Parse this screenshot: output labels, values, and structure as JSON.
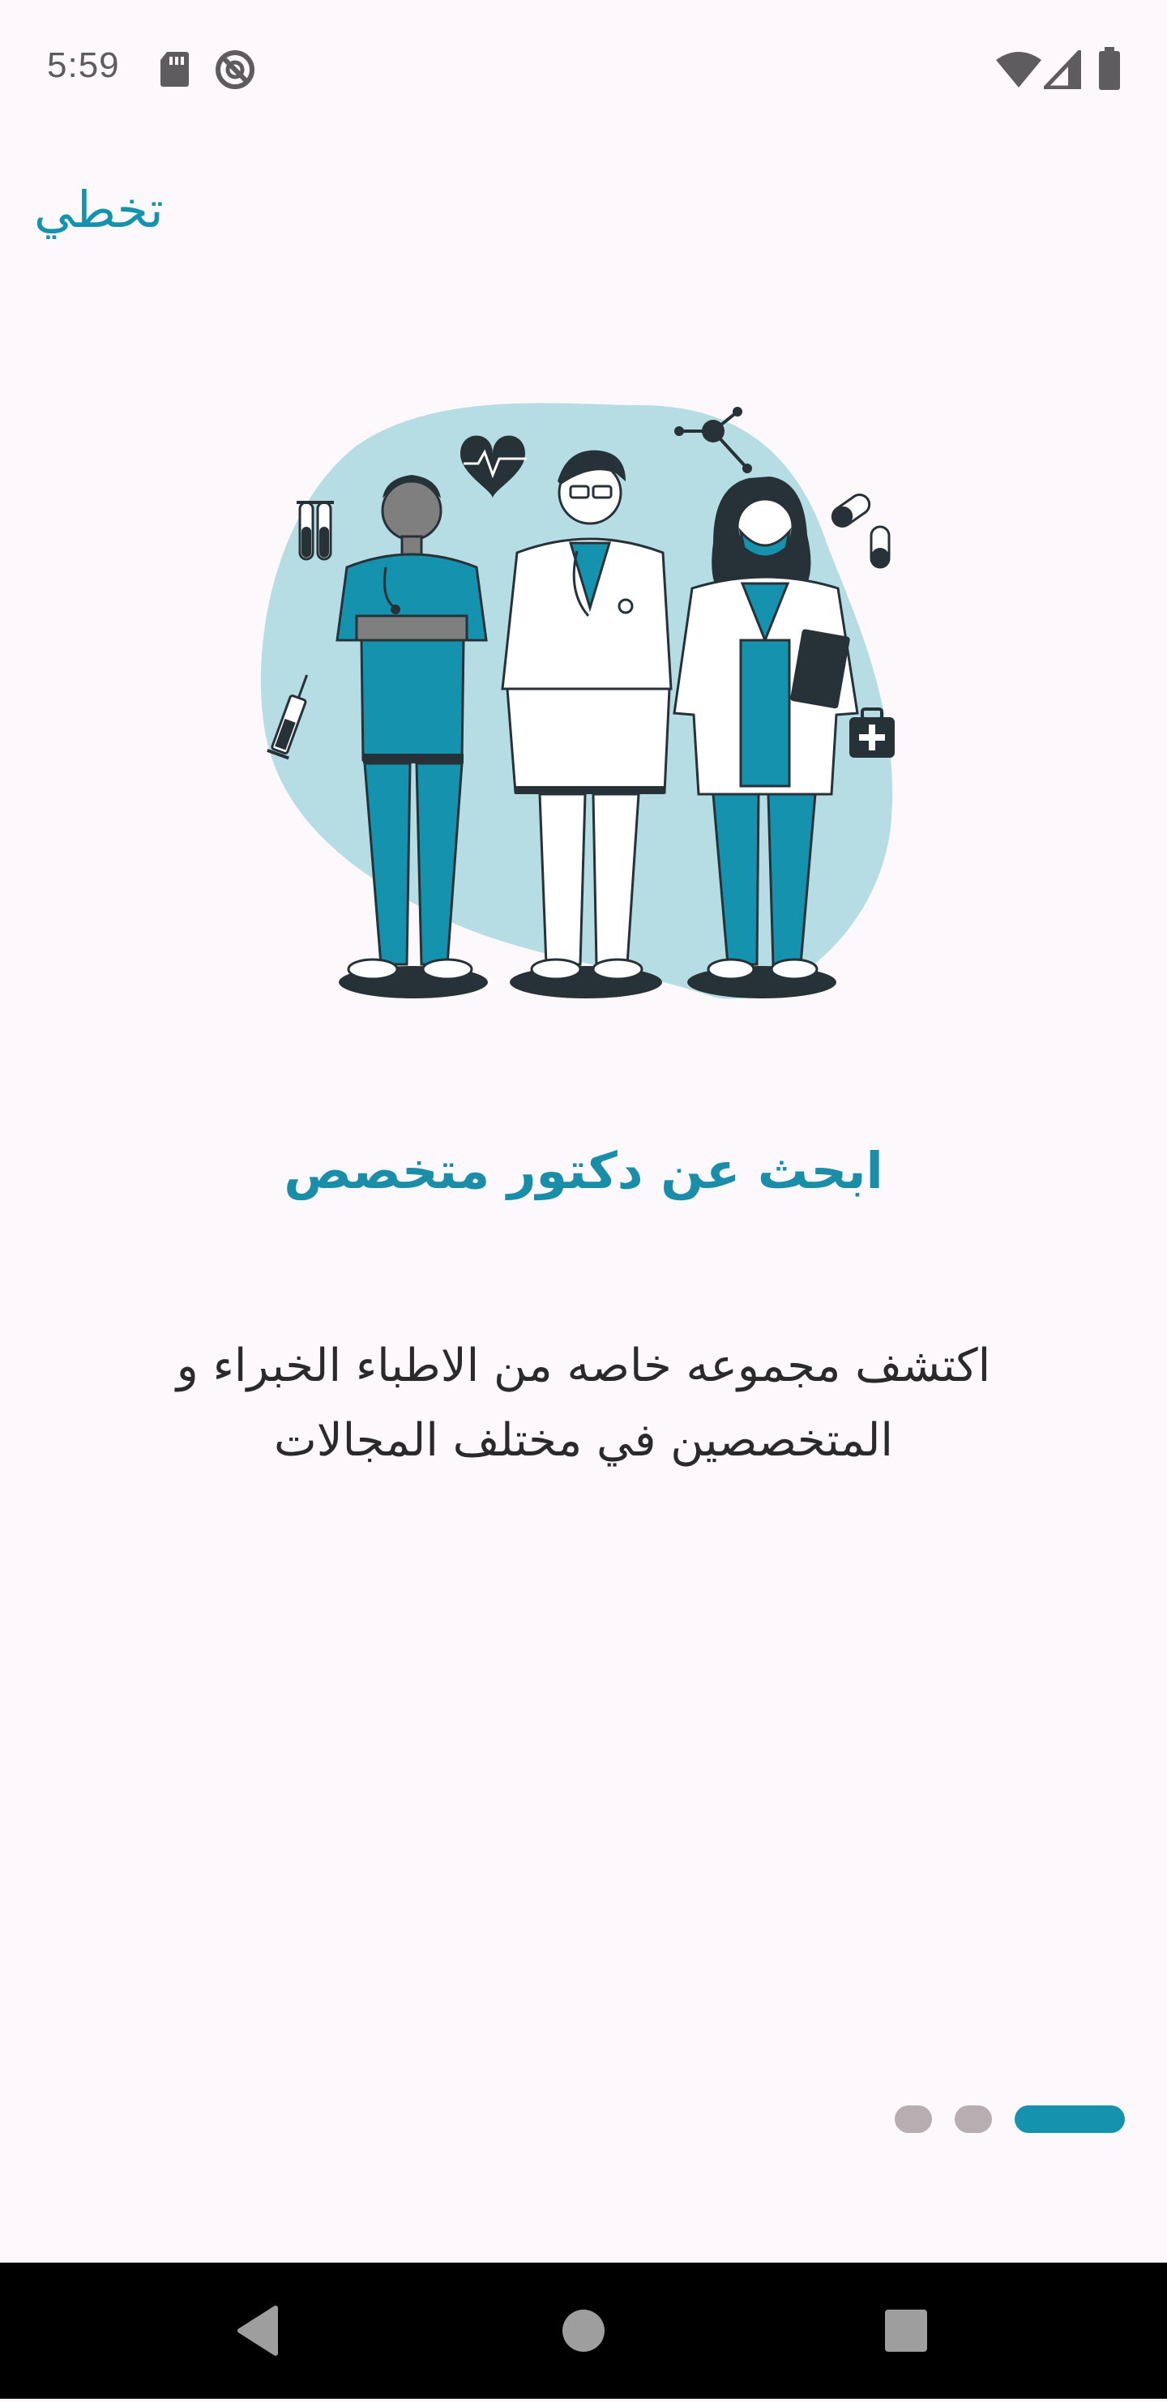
{
  "status_bar": {
    "time": "5:59",
    "icons_left": [
      "sd-card-icon",
      "data-saver-icon"
    ],
    "icons_right": [
      "wifi-icon",
      "cellular-signal-icon",
      "battery-icon"
    ]
  },
  "header": {
    "skip_label": "تخطي"
  },
  "illustration": {
    "icon": "doctors-illustration"
  },
  "onboarding": {
    "title": "ابحث عن دكتور متخصص",
    "description_line1": "اكتشف مجموعه خاصه من الاطباء الخبراء و",
    "description_line2": "المتخصصين في مختلف المجالات"
  },
  "pager": {
    "page_count": 3,
    "active_index": 2
  },
  "colors": {
    "accent": "#1592ad",
    "background": "#fdf8fb",
    "dot_inactive": "#b8adb1",
    "blob": "#b5dde3"
  },
  "nav_bar": {
    "buttons": [
      "back-icon",
      "home-icon",
      "recents-icon"
    ]
  }
}
